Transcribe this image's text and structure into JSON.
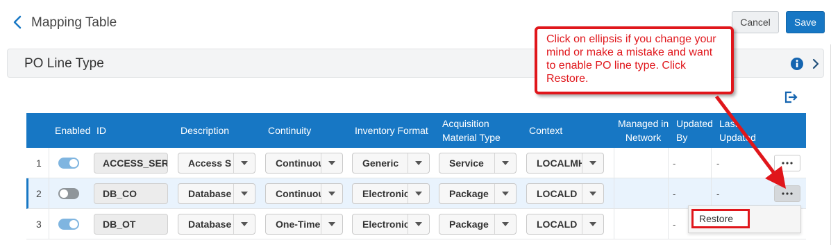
{
  "header": {
    "title": "Mapping Table",
    "cancel_label": "Cancel",
    "save_label": "Save"
  },
  "section": {
    "title": "PO Line Type"
  },
  "columns": {
    "enabled": "Enabled",
    "id": "ID",
    "description": "Description",
    "continuity": "Continuity",
    "inventory_format": "Inventory Format",
    "acq_type_1": "Acquisition",
    "acq_type_2": "Material Type",
    "context": "Context",
    "managed_1": "Managed in",
    "managed_2": "Network",
    "updated_1": "Updated",
    "updated_2": "By",
    "last_1": "Last",
    "last_2": "Updated"
  },
  "rows": [
    {
      "num": "1",
      "enabled": true,
      "id": "ACCESS_SER",
      "description": "Access S",
      "continuity": "Continuous",
      "inventory_format": "Generic",
      "acquisition_material_type": "Service",
      "context": "LOCALMH",
      "updated_by": "-",
      "last_updated": "-"
    },
    {
      "num": "2",
      "enabled": false,
      "id": "DB_CO",
      "description": "Database",
      "continuity": "Continuous",
      "inventory_format": "Electronic",
      "acquisition_material_type": "Package",
      "context": "LOCALD",
      "updated_by": "-",
      "last_updated": "-"
    },
    {
      "num": "3",
      "enabled": true,
      "id": "DB_OT",
      "description": "Database",
      "continuity": "One-Time",
      "inventory_format": "Electronic",
      "acquisition_material_type": "Package",
      "context": "LOCALD",
      "updated_by": "-",
      "last_updated": ""
    }
  ],
  "row_actions_menu": {
    "items": [
      "Restore"
    ]
  },
  "callout": {
    "text": "Click on ellipsis if you change your mind or make a mistake and want to enable PO line type. Click Restore."
  },
  "colors": {
    "header_blue": "#1777c4",
    "annotation_red": "#e0161b",
    "toggle_on": "#7fb5e0",
    "toggle_off": "#8f959a"
  }
}
